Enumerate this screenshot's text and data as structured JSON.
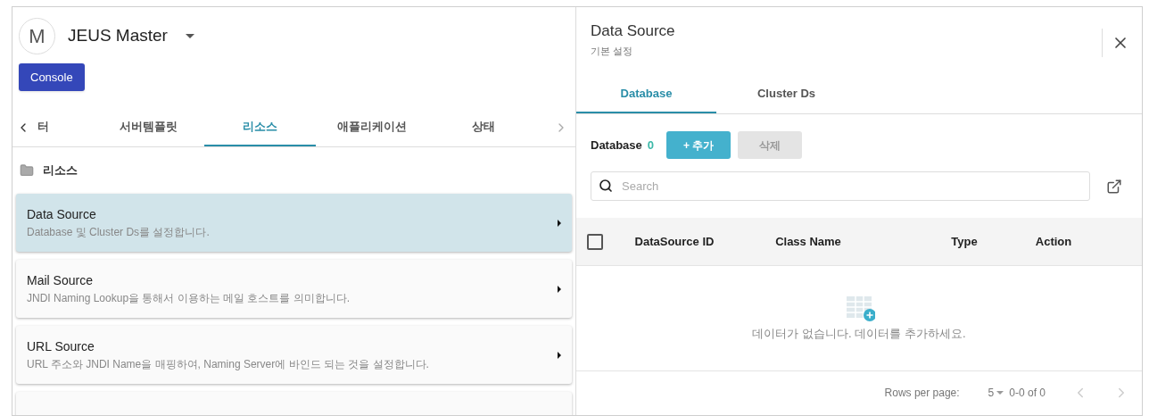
{
  "header": {
    "avatar": "M",
    "title": "JEUS Master",
    "button": "Console"
  },
  "tabs": [
    {
      "label": "터",
      "selected": false
    },
    {
      "label": "서버템플릿",
      "selected": false
    },
    {
      "label": "리소스",
      "selected": true
    },
    {
      "label": "애플리케이션",
      "selected": false
    },
    {
      "label": "상태",
      "selected": false
    }
  ],
  "section": {
    "title": "리소스"
  },
  "items": [
    {
      "title": "Data Source",
      "description": "Database 및 Cluster Ds를 설정합니다.",
      "selected": true
    },
    {
      "title": "Mail Source",
      "description": "JNDI Naming Lookup을 통해서 이용하는 메일 호스트를 의미합니다.",
      "selected": false
    },
    {
      "title": "URL Source",
      "description": "URL 주소와 JNDI Name을 매핑하여, Naming Server에 바인드 되는 것을 설정합니다.",
      "selected": false
    },
    {
      "selected": false
    }
  ],
  "panel": {
    "title": "Data Source",
    "subtitle": "기본 설정",
    "tabs": [
      {
        "label": "Database",
        "selected": true
      },
      {
        "label": "Cluster Ds",
        "selected": false
      }
    ],
    "toolbar": {
      "label": "Database",
      "count": "0",
      "buttons": [
        {
          "label": "+ 추가",
          "disabled": false
        },
        {
          "label": "삭제",
          "disabled": true
        }
      ]
    },
    "search": {
      "placeholder": "Search"
    },
    "table": {
      "checked": false,
      "columns": [
        "DataSource ID",
        "Class Name",
        "Type",
        "Action"
      ],
      "empty_message": "데이터가 없습니다. 데이터를 추가하세요."
    },
    "pagination": {
      "rows_label": "Rows per page:",
      "rows_value": "5",
      "range": "0-0 of 0"
    }
  }
}
